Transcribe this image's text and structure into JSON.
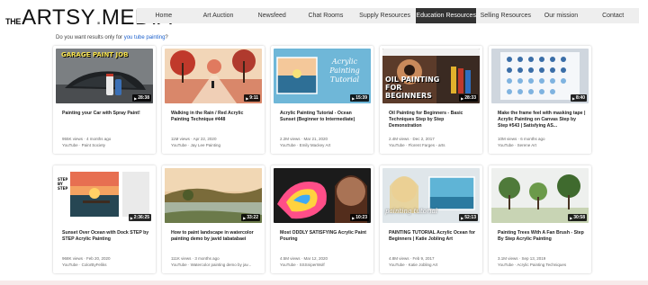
{
  "logo": {
    "the": "THE",
    "artsy": "ARTSY",
    "dot": ".",
    "media": "MEDIA"
  },
  "nav": {
    "items": [
      {
        "label": "Home"
      },
      {
        "label": "Art Auction"
      },
      {
        "label": "Newsfeed"
      },
      {
        "label": "Chat Rooms"
      },
      {
        "label": "Supply Resources"
      },
      {
        "label": "Education Resources"
      },
      {
        "label": "Selling Resources"
      },
      {
        "label": "Our mission"
      },
      {
        "label": "Contact"
      }
    ],
    "active": "Education Resources"
  },
  "suggest": {
    "prefix": "Do you want results only for ",
    "link": "you tube painting",
    "suffix": "?"
  },
  "videos": [
    {
      "title": "Painting your Car with Spray Paint!",
      "views": "955K views · 4 months ago",
      "channel": "YouTube · Paint Society",
      "duration": "28:38",
      "thumb_text": "GARAGE PAINT JOB"
    },
    {
      "title": "Walking in the Rain / Red Acrylic Painting Technique #448",
      "views": "11M views · Apr 22, 2020",
      "channel": "YouTube · Jay Lee Painting",
      "duration": "9:11",
      "thumb_text": ""
    },
    {
      "title": "Acrylic Painting Tutorial - Ocean Sunset (Beginner to Intermediate)",
      "views": "2.2M views · Mar 21, 2020",
      "channel": "YouTube · Emily Mackey Art",
      "duration": "15:39",
      "thumb_text": "Acrylic Painting Tutorial"
    },
    {
      "title": "Oil Painting for Beginners - Basic Techniques Step by Step Demonstration",
      "views": "2.4M views · Dec 2, 2017",
      "channel": "YouTube · Florent Farges - arts",
      "duration": "28:33",
      "thumb_text": "OIL PAINTING FOR BEGINNERS"
    },
    {
      "title": "Make the frame feel with masking tape | Acrylic Painting on Canvas Step by Step #543 | Satisfying AS...",
      "views": "10M views · 6 months ago",
      "channel": "YouTube · Serene Art",
      "duration": "8:40",
      "thumb_text": ""
    },
    {
      "title": "Sunset Over Ocean with Dock STEP by STEP Acrylic Painting",
      "views": "968K views · Feb 20, 2020",
      "channel": "YouTube · ColorByFeliks",
      "duration": "2:36:25",
      "thumb_text": "STEP BY STEP"
    },
    {
      "title": "How to paint landscape in watercolor painting demo by javid tabatabaei",
      "views": "111K views · 3 months ago",
      "channel": "YouTube · Watercolor painting demo by jav...",
      "duration": "33:22",
      "thumb_text": ""
    },
    {
      "title": "Most ODDLY SATISFYING Acrylic Paint Pouring",
      "views": "4.5M views · Mar 12, 2020",
      "channel": "YouTube · SSSniperWolf",
      "duration": "10:23",
      "thumb_text": ""
    },
    {
      "title": "PAINTING TUTORIAL Acrylic Ocean for Beginners | Katie Jobling Art",
      "views": "4.8M views · Feb 9, 2017",
      "channel": "YouTube · Katie Jobling Art",
      "duration": "52:13",
      "thumb_text": "painting tutorial"
    },
    {
      "title": "Painting Trees With A Fan Brush - Step By Step Acrylic Painting",
      "views": "3.1M views · Sep 13, 2019",
      "channel": "YouTube · Acrylic Painting Techniques",
      "duration": "30:58",
      "thumb_text": ""
    }
  ],
  "colors": {
    "nav_bg": "#eeeeee",
    "nav_active": "#333333",
    "link": "#1a5fcc"
  },
  "icons": {
    "play": "play-icon"
  }
}
